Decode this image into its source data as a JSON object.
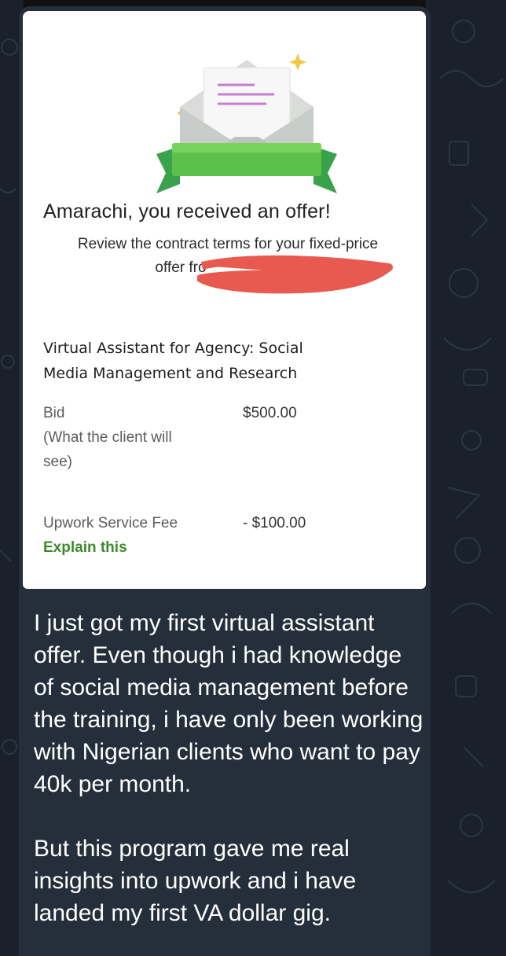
{
  "colors": {
    "background": "#1a212b",
    "bubble": "#252f3b",
    "card": "#ffffff",
    "accent_green": "#3d8a2e",
    "redaction": "#e8594f"
  },
  "offer_card": {
    "title": "Amarachi,  you received an offer!",
    "subtitle_line1": "Review the contract terms for your fixed-price",
    "subtitle_line2": "offer fro",
    "job_title_line1": "Virtual Assistant for Agency: Social",
    "job_title_line2": "Media Management and Research",
    "bid_label": "Bid",
    "bid_note_line1": "(What the client will",
    "bid_note_line2": "see)",
    "bid_value": "$500.00",
    "fee_label": "Upwork Service Fee",
    "fee_value": "- $100.00",
    "explain_link": "Explain this"
  },
  "message": {
    "paragraph1": "I just got my first virtual assistant offer. Even though i had knowledge of social media management before the training, i have only been working with Nigerian clients who want to pay 40k per month.",
    "paragraph2": "But this program gave me real insights into upwork and i have landed my first VA dollar gig."
  }
}
